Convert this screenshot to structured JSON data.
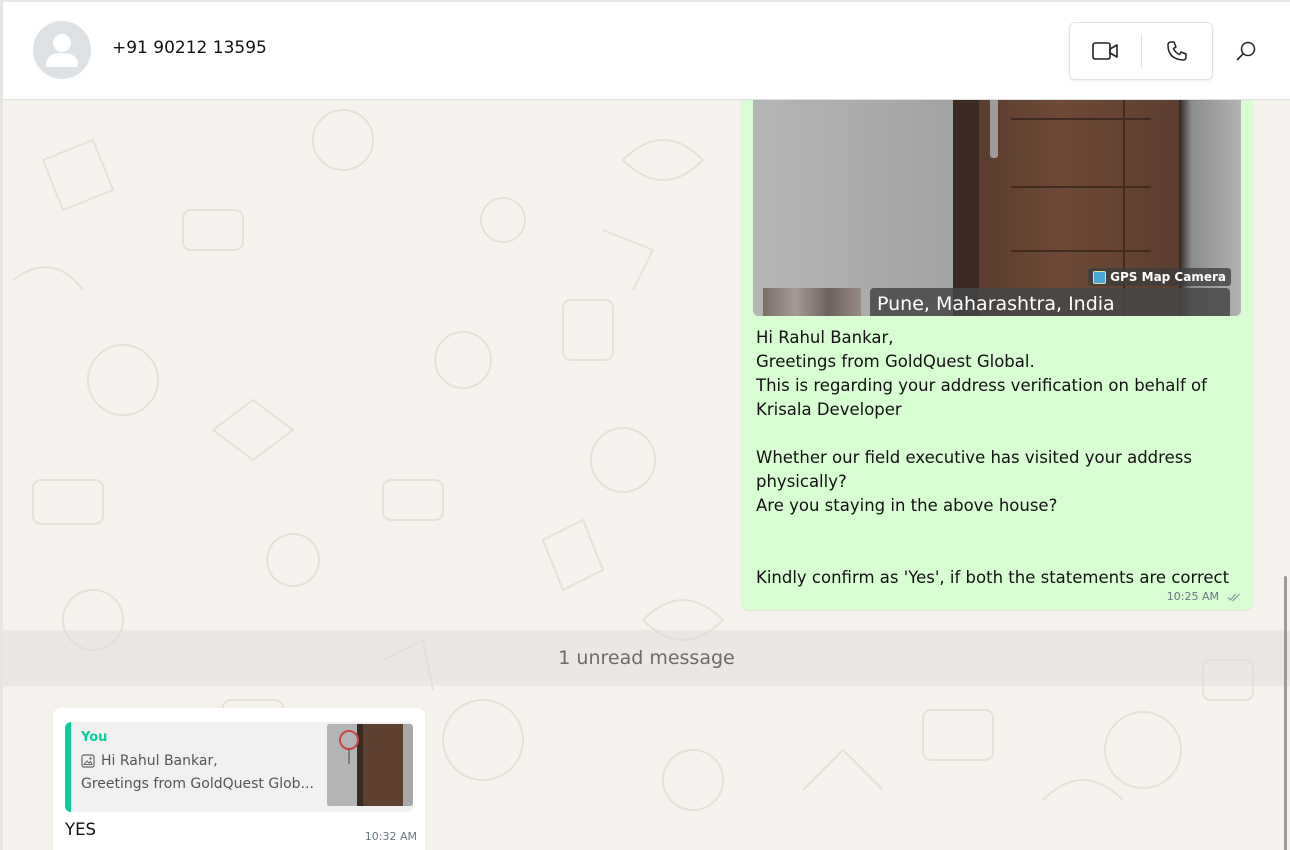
{
  "header": {
    "contact_name": "+91 90212 13595"
  },
  "icons": {
    "avatar": "person-placeholder-icon",
    "video": "video-camera-icon",
    "voice": "phone-icon",
    "search": "magnifier-icon",
    "read_receipt": "double-check-icon",
    "image": "image-icon"
  },
  "outgoing_message": {
    "photo_overlay_brand": "GPS Map Camera",
    "photo_overlay_location": "Pune, Maharashtra, India",
    "lines": [
      "Hi Rahul Bankar,",
      "Greetings from GoldQuest Global.",
      "This is regarding your address verification on behalf of",
      "Krisala Developer",
      "",
      "Whether our field executive has visited your address",
      "physically?",
      "Are you staying in the above house?",
      "",
      "",
      "Kindly confirm as 'Yes', if both the statements are correct"
    ],
    "time": "10:25 AM"
  },
  "unread_banner": "1 unread message",
  "incoming_message": {
    "quote_author": "You",
    "quote_line1": "Hi Rahul Bankar,",
    "quote_line2": "Greetings from GoldQuest Glob...",
    "text": "YES",
    "time": "10:32 AM"
  },
  "colors": {
    "outgoing_bubble": "#d9fdd3",
    "chat_background": "#f5f1ec",
    "quote_accent": "#06cf9c",
    "read_tick": "#8696a0"
  }
}
